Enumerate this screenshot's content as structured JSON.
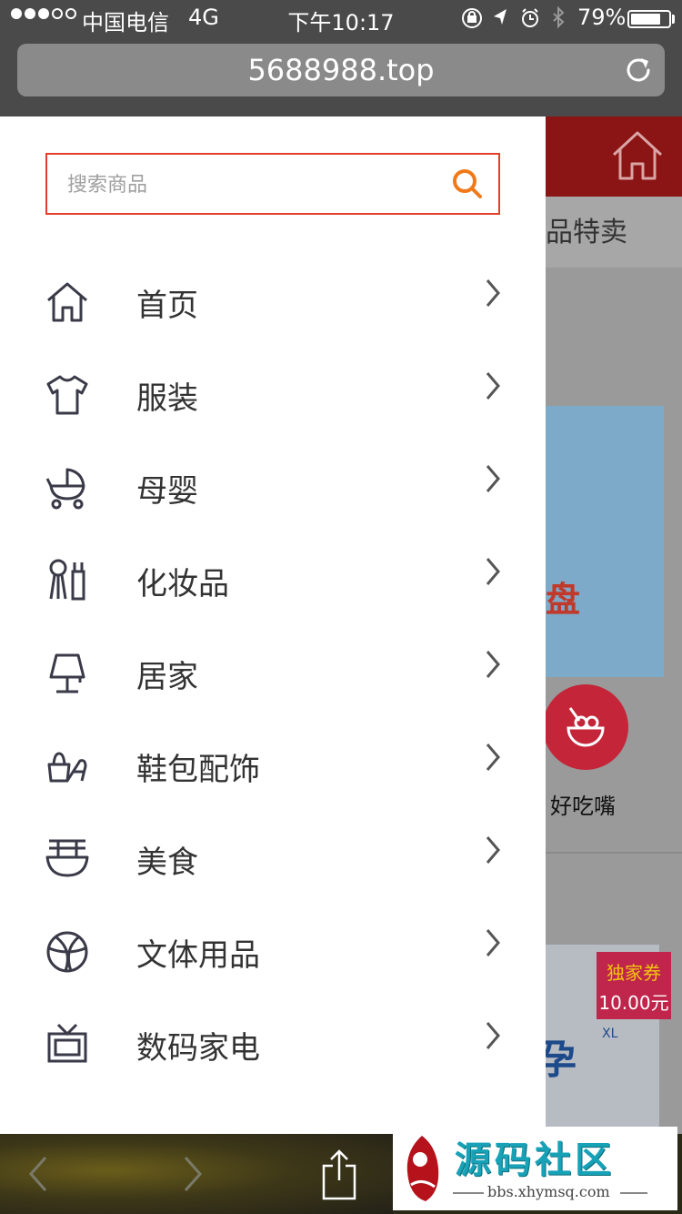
{
  "status_bar": {
    "signal_dots": [
      true,
      true,
      true,
      false,
      false
    ],
    "carrier": "中国电信",
    "network": "4G",
    "time": "下午10:17",
    "icons": [
      "orientation-lock-icon",
      "location-arrow-icon",
      "alarm-icon",
      "bluetooth-icon"
    ],
    "battery_percent": "79%",
    "battery_level": 0.79
  },
  "browser": {
    "url": "5688988.top",
    "reload_icon": "reload-icon"
  },
  "drawer": {
    "search_placeholder": "搜索商品",
    "search_icon": "search-icon",
    "accent_color": "#e23e2e",
    "items": [
      {
        "label": "首页",
        "icon": "home-icon"
      },
      {
        "label": "服装",
        "icon": "tshirt-icon"
      },
      {
        "label": "母婴",
        "icon": "stroller-icon"
      },
      {
        "label": "化妆品",
        "icon": "cosmetics-icon"
      },
      {
        "label": "居家",
        "icon": "lamp-icon"
      },
      {
        "label": "鞋包配饰",
        "icon": "bag-shoe-icon"
      },
      {
        "label": "美食",
        "icon": "food-bowl-icon"
      },
      {
        "label": "文体用品",
        "icon": "basketball-icon"
      },
      {
        "label": "数码家电",
        "icon": "tv-icon"
      }
    ]
  },
  "background_page": {
    "tab_text": "品特卖",
    "banner_text": "盘",
    "category_label": "好吃嘴",
    "coupon_title": "独家券",
    "coupon_value": "10.00元",
    "product_logo_text": "孕",
    "product_size": "XL"
  },
  "toolbar": {
    "back_icon": "back-chevron-icon",
    "forward_icon": "forward-chevron-icon",
    "share_icon": "share-icon"
  },
  "watermark": {
    "title": "源码社区",
    "url": "bbs.xhymsq.com"
  }
}
